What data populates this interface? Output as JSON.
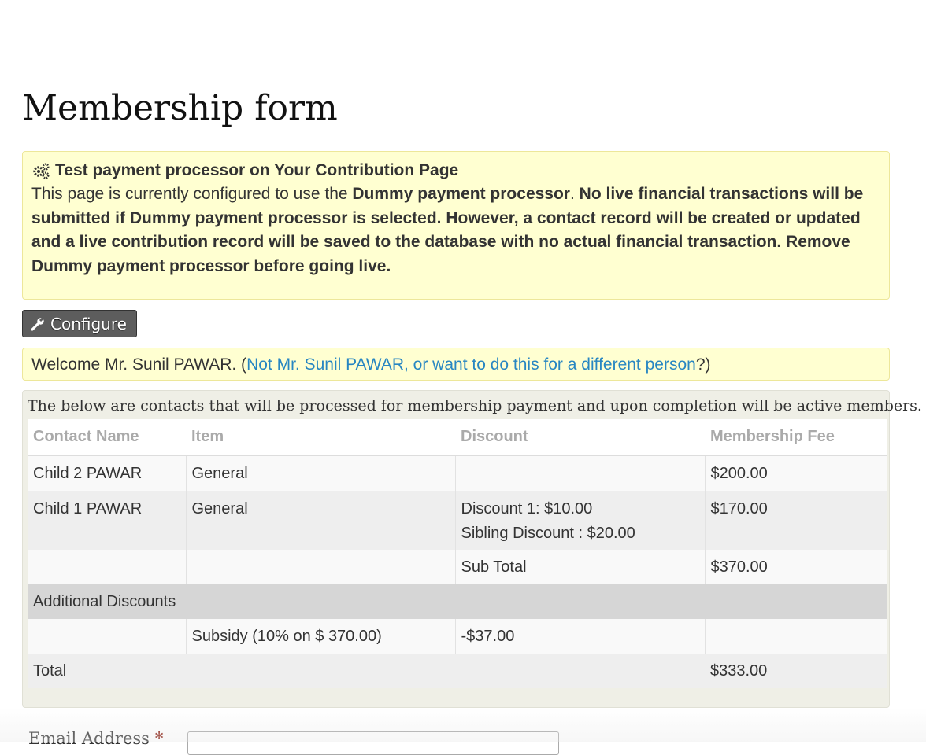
{
  "page": {
    "title": "Membership form"
  },
  "notice": {
    "title": "Test payment processor on Your Contribution Page",
    "text_before": "This page is currently configured to use the ",
    "processor_name": "Dummy payment processor",
    "text_middle": ". ",
    "warning": "No live financial transactions will be submitted if Dummy payment processor is selected. However, a contact record will be created or updated and a live contribution record will be saved to the database with no actual financial transaction. Remove Dummy payment processor before going live."
  },
  "configure_button": {
    "label": "Configure"
  },
  "welcome": {
    "text": "Welcome Mr. Sunil PAWAR. (",
    "link": "Not Mr. Sunil PAWAR, or want to do this for a different person",
    "suffix": "?)"
  },
  "members": {
    "intro": "The below are contacts that will be processed for membership payment and upon completion will be active members.",
    "headers": [
      "Contact Name",
      "Item",
      "Discount",
      "Membership Fee"
    ],
    "rows": [
      {
        "contact": "Child 2 PAWAR",
        "item": "General",
        "discount_lines": [],
        "fee": "$200.00"
      },
      {
        "contact": "Child 1 PAWAR",
        "item": "General",
        "discount_lines": [
          "Discount 1:  $10.00",
          "Sibling Discount : $20.00"
        ],
        "fee": "$170.00"
      }
    ],
    "subtotal": {
      "label": "Sub Total",
      "value": "$370.00"
    },
    "additional_discounts_label": "Additional Discounts",
    "subsidy": {
      "item": "Subsidy (10% on $ 370.00)",
      "discount": "-$37.00"
    },
    "total": {
      "label": "Total",
      "value": "$333.00"
    }
  },
  "email": {
    "label": "Email Address",
    "required_marker": "*",
    "value": ""
  },
  "colors": {
    "notice_bg": "#ffffd1",
    "link": "#2786c2",
    "button_bg": "#5d5d5d"
  }
}
